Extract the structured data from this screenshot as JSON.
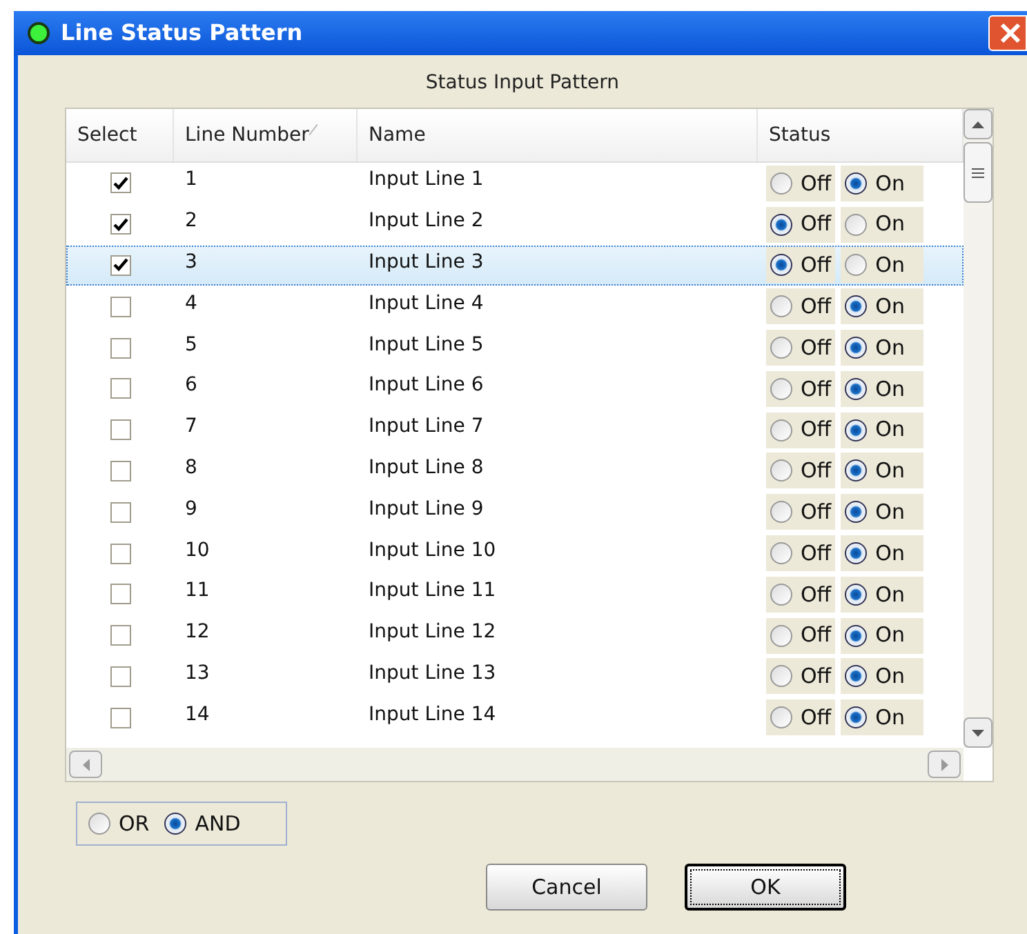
{
  "window": {
    "title": "Line Status Pattern"
  },
  "subtitle": "Status Input Pattern",
  "table": {
    "columns": [
      {
        "label": "Select",
        "sorted": false
      },
      {
        "label": "Line Number",
        "sorted": true
      },
      {
        "label": "Name",
        "sorted": false
      },
      {
        "label": "Status",
        "sorted": false
      }
    ],
    "rows": [
      {
        "checked": true,
        "line": "1",
        "name": "Input Line 1",
        "selected": false,
        "status": [
          {
            "label": "Off",
            "selected": false
          },
          {
            "label": "On",
            "selected": true
          }
        ]
      },
      {
        "checked": true,
        "line": "2",
        "name": "Input Line 2",
        "selected": false,
        "status": [
          {
            "label": "Off",
            "selected": true
          },
          {
            "label": "On",
            "selected": false
          }
        ]
      },
      {
        "checked": true,
        "line": "3",
        "name": "Input Line 3",
        "selected": true,
        "status": [
          {
            "label": "Off",
            "selected": true
          },
          {
            "label": "On",
            "selected": false
          }
        ]
      },
      {
        "checked": false,
        "line": "4",
        "name": "Input Line 4",
        "selected": false,
        "status": [
          {
            "label": "Off",
            "selected": false
          },
          {
            "label": "On",
            "selected": true
          }
        ]
      },
      {
        "checked": false,
        "line": "5",
        "name": "Input Line 5",
        "selected": false,
        "status": [
          {
            "label": "Off",
            "selected": false
          },
          {
            "label": "On",
            "selected": true
          }
        ]
      },
      {
        "checked": false,
        "line": "6",
        "name": "Input Line 6",
        "selected": false,
        "status": [
          {
            "label": "Off",
            "selected": false
          },
          {
            "label": "On",
            "selected": true
          }
        ]
      },
      {
        "checked": false,
        "line": "7",
        "name": "Input Line 7",
        "selected": false,
        "status": [
          {
            "label": "Off",
            "selected": false
          },
          {
            "label": "On",
            "selected": true
          }
        ]
      },
      {
        "checked": false,
        "line": "8",
        "name": "Input Line 8",
        "selected": false,
        "status": [
          {
            "label": "Off",
            "selected": false
          },
          {
            "label": "On",
            "selected": true
          }
        ]
      },
      {
        "checked": false,
        "line": "9",
        "name": "Input Line 9",
        "selected": false,
        "status": [
          {
            "label": "Off",
            "selected": false
          },
          {
            "label": "On",
            "selected": true
          }
        ]
      },
      {
        "checked": false,
        "line": "10",
        "name": "Input Line 10",
        "selected": false,
        "status": [
          {
            "label": "Off",
            "selected": false
          },
          {
            "label": "On",
            "selected": true
          }
        ]
      },
      {
        "checked": false,
        "line": "11",
        "name": "Input Line 11",
        "selected": false,
        "status": [
          {
            "label": "Off",
            "selected": false
          },
          {
            "label": "On",
            "selected": true
          }
        ]
      },
      {
        "checked": false,
        "line": "12",
        "name": "Input Line 12",
        "selected": false,
        "status": [
          {
            "label": "Off",
            "selected": false
          },
          {
            "label": "On",
            "selected": true
          }
        ]
      },
      {
        "checked": false,
        "line": "13",
        "name": "Input Line 13",
        "selected": false,
        "status": [
          {
            "label": "Off",
            "selected": false
          },
          {
            "label": "On",
            "selected": true
          }
        ]
      },
      {
        "checked": false,
        "line": "14",
        "name": "Input Line 14",
        "selected": false,
        "status": [
          {
            "label": "Off",
            "selected": false
          },
          {
            "label": "On",
            "selected": true
          }
        ]
      }
    ]
  },
  "logic": [
    {
      "label": "OR",
      "selected": false
    },
    {
      "label": "AND",
      "selected": true
    }
  ],
  "buttons": [
    {
      "label": "Cancel",
      "default": false
    },
    {
      "label": "OK",
      "default": true
    }
  ]
}
